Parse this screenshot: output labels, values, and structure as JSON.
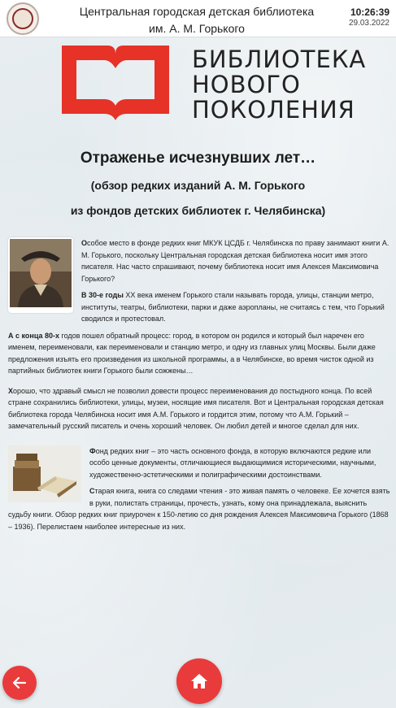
{
  "header": {
    "org_title_line1": "Центральная городская детская библиотека",
    "org_title_line2": "им. А. М. Горького",
    "time": "10:26:39",
    "date": "29.03.2022"
  },
  "logo": {
    "line1": "БИБЛИОТЕКА",
    "line2": "НОВОГО",
    "line3": "ПОКОЛЕНИЯ",
    "accent_color": "#e63227"
  },
  "article": {
    "title": "Отраженье исчезнувших лет…",
    "subtitle_line1": "(обзор редких изданий А. М. Горького",
    "subtitle_line2": "из фондов детских библиотек г. Челябинска)",
    "p1_lead": "О",
    "p1_text": "собое место в фонде редких книг МКУК ЦСДБ  г. Челябинска по праву занимают книги А. М. Горького, поскольку Центральная городская детская библиотека носит имя этого писателя. Нас часто спрашивают, почему библиотека носит имя Алексея Максимовича Горького?",
    "p2_bold": "В 30-е годы",
    "p2_text": " XX века именем Горького стали называть города, улицы, станции метро, институты, театры, библиотеки, парки и даже аэропланы, не считаясь с тем, что Горький сводился и протестовал.",
    "p3_bold": "А с конца 80-х",
    "p3_text": " годов пошел обратный процесс: город, в котором он родился и который был наречен его именем, переименовали, как переименовали и станцию метро, и одну из главных улиц Москвы. Были даже предложения изъять его произведения из школьной программы, а в Челябинске, во время чисток одной из партийных библиотек книги Горького были сожжены…",
    "p4_lead": "Х",
    "p4_text": "орошо, что здравый смысл не позволил довести процесс переименования до постыдного конца. По всей стране сохранились  библиотеки, улицы, музеи, носящие имя писателя. Вот и Центральная городская детская библиотека города Челябинска носит имя А.М. Горького и гордится этим, потому что А.М. Горький – замечательный русский писатель и очень хороший человек.  Он любил детей и многое сделал для них.",
    "p5_lead": "Ф",
    "p5_text": "онд редких книг – это часть основного фонда, в которую включаются редкие или особо ценные документы, отличающиеся выдающимися историческими, научными, художественно-эстетическими и полиграфическими достоинствами.",
    "p6_lead": "С",
    "p6_text": "тарая книга, книга со следами чтения - это живая память о человеке. Ее хочется взять в руки, полистать страницы, прочесть, узнать, кому она принадлежала, выяснить судьбу книги. Обзор редких книг приурочен к  150-летию со дня рождения Алексея Максимовича Горького (1868 – 1936). Перелистаем наиболее интересные из них."
  },
  "nav": {
    "back_icon": "arrow-left-icon",
    "home_icon": "home-icon",
    "button_color": "#e93b3b"
  }
}
